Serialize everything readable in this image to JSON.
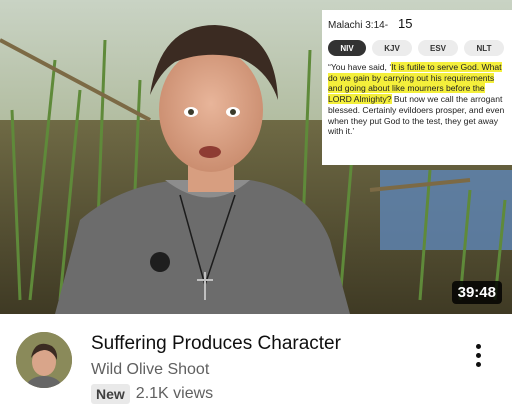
{
  "video": {
    "duration": "39:48",
    "title": "Suffering Produces Character",
    "channel": "Wild Olive Shoot",
    "badge": "New",
    "views": "2.1K views"
  },
  "verse_overlay": {
    "reference": "Malachi 3:14-",
    "verse_number": "15",
    "translations": [
      "NIV",
      "KJV",
      "ESV",
      "NLT"
    ],
    "active_translation": "NIV",
    "text_before": "“You have said, ‘",
    "text_highlighted": "It is futile to serve God. What do we gain by carrying out his requirements and going about like mourners before the LORD Almighty?",
    "text_after": " But now we call the arrogant blessed. Certainly evildoers prosper, and even when they put God to the test, they get away with it.’"
  },
  "icons": {
    "more": "more-vert-icon"
  },
  "colors": {
    "highlight": "#f4ef3b",
    "title": "#0f0f0f",
    "meta": "#606060"
  }
}
